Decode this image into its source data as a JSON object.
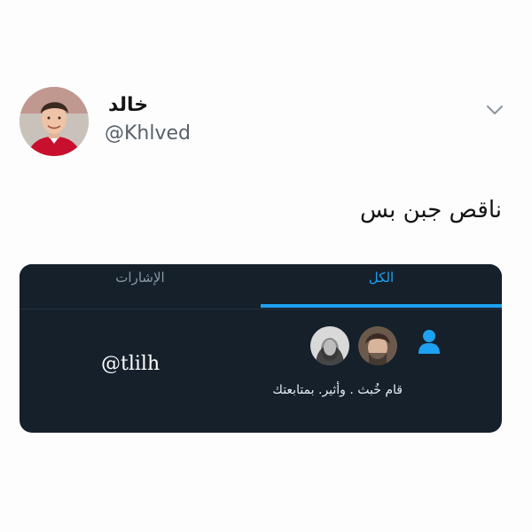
{
  "tweet": {
    "author_name": "خالد",
    "author_handle": "@Khlved",
    "text": "ناقص جبن بس"
  },
  "embedded_notification": {
    "tabs": [
      {
        "label": "الإشارات",
        "active": false
      },
      {
        "label": "الكل",
        "active": true
      }
    ],
    "follower_handle": "@tlilh",
    "message": "قام خُبث . وأثير. بمتابعتك",
    "accent_color": "#1da1f2",
    "background_color": "#15202b"
  },
  "icons": {
    "menu": "chevron-down-icon",
    "notification": "person-icon"
  }
}
